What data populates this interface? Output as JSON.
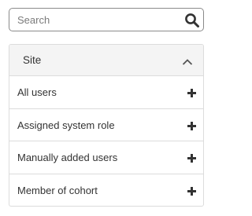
{
  "search": {
    "placeholder": "Search",
    "value": "",
    "icon": "search-icon"
  },
  "panel": {
    "title": "Site",
    "expanded": true,
    "toggle_icon": "chevron-up-icon",
    "items": [
      {
        "label": "All users",
        "icon": "plus-icon"
      },
      {
        "label": "Assigned system role",
        "icon": "plus-icon"
      },
      {
        "label": "Manually added users",
        "icon": "plus-icon"
      },
      {
        "label": "Member of cohort",
        "icon": "plus-icon"
      }
    ]
  },
  "colors": {
    "text": "#333333",
    "border": "#dcdcdc",
    "header_bg": "#f4f4f4",
    "search_border": "#8a8a8a"
  }
}
